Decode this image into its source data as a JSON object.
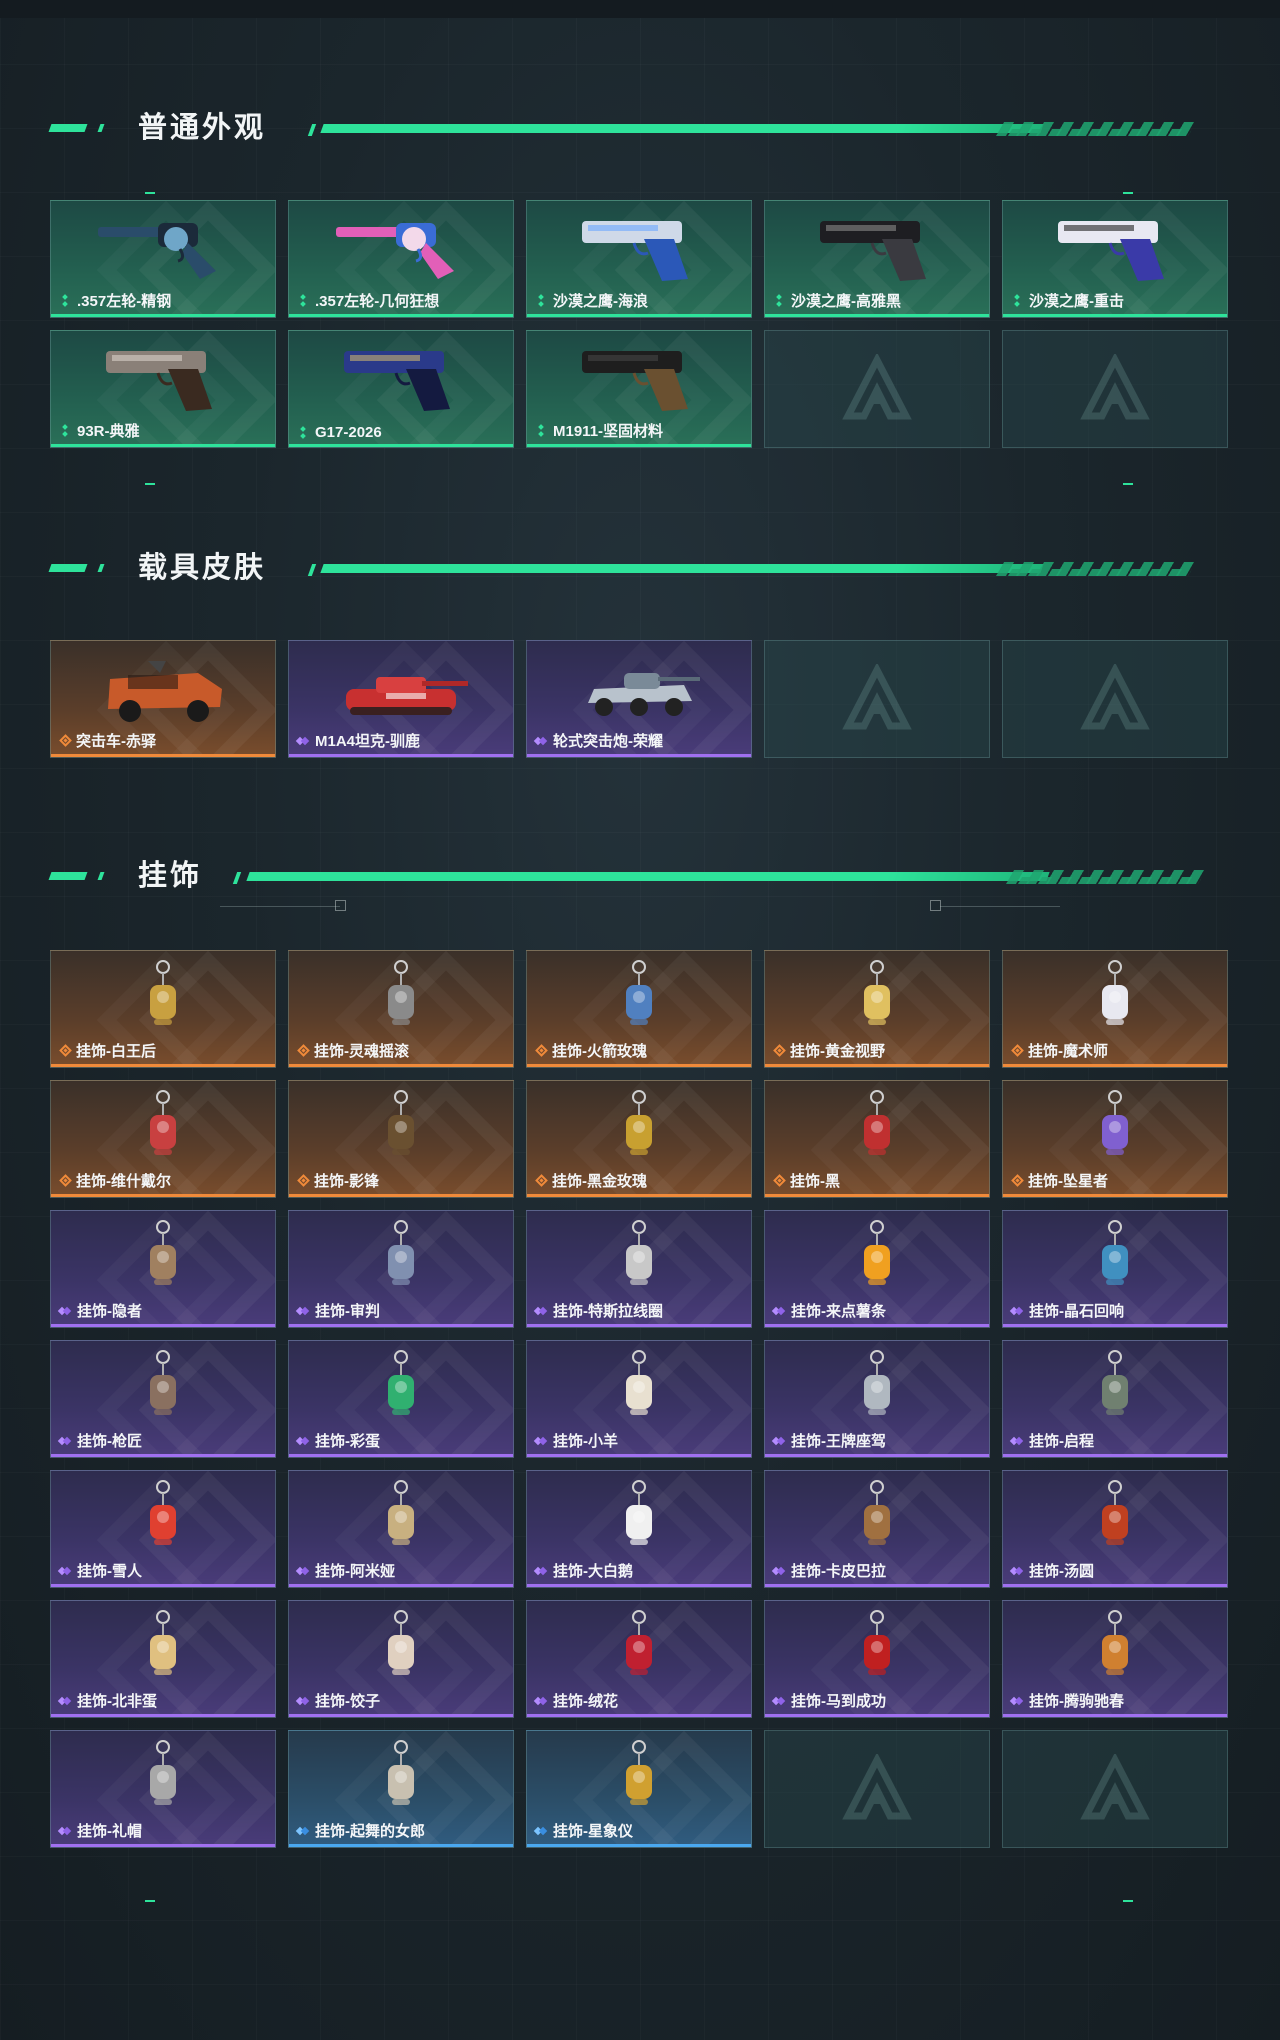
{
  "sections": {
    "weapons": {
      "title": "普通外观"
    },
    "vehicles": {
      "title": "载具皮肤"
    },
    "charms": {
      "title": "挂饰"
    }
  },
  "weapons": [
    {
      "label": ".357左轮-精钢",
      "rarity": "green",
      "icon": "revolver-icon"
    },
    {
      "label": ".357左轮-几何狂想",
      "rarity": "green",
      "icon": "revolver-icon"
    },
    {
      "label": "沙漠之鹰-海浪",
      "rarity": "green",
      "icon": "pistol-icon"
    },
    {
      "label": "沙漠之鹰-高雅黑",
      "rarity": "green",
      "icon": "pistol-icon"
    },
    {
      "label": "沙漠之鹰-重击",
      "rarity": "green",
      "icon": "pistol-icon"
    },
    {
      "label": "93R-典雅",
      "rarity": "green",
      "icon": "pistol-icon"
    },
    {
      "label": "G17-2026",
      "rarity": "green",
      "icon": "pistol-icon"
    },
    {
      "label": "M1911-坚固材料",
      "rarity": "green",
      "icon": "pistol-icon"
    }
  ],
  "vehicles": [
    {
      "label": "突击车-赤驿",
      "rarity": "orange",
      "icon": "assault-vehicle-icon"
    },
    {
      "label": "M1A4坦克-驯鹿",
      "rarity": "purple",
      "icon": "tank-icon"
    },
    {
      "label": "轮式突击炮-荣耀",
      "rarity": "purple",
      "icon": "wheeled-gun-icon"
    }
  ],
  "charms": [
    {
      "label": "挂饰-白王后",
      "rarity": "orange"
    },
    {
      "label": "挂饰-灵魂摇滚",
      "rarity": "orange"
    },
    {
      "label": "挂饰-火箭玫瑰",
      "rarity": "orange"
    },
    {
      "label": "挂饰-黄金视野",
      "rarity": "orange"
    },
    {
      "label": "挂饰-魔术师",
      "rarity": "orange"
    },
    {
      "label": "挂饰-维什戴尔",
      "rarity": "orange"
    },
    {
      "label": "挂饰-影锋",
      "rarity": "orange"
    },
    {
      "label": "挂饰-黑金玫瑰",
      "rarity": "orange"
    },
    {
      "label": "挂饰-黑",
      "rarity": "orange"
    },
    {
      "label": "挂饰-坠星者",
      "rarity": "orange"
    },
    {
      "label": "挂饰-隐者",
      "rarity": "purple"
    },
    {
      "label": "挂饰-审判",
      "rarity": "purple"
    },
    {
      "label": "挂饰-特斯拉线圈",
      "rarity": "purple"
    },
    {
      "label": "挂饰-来点薯条",
      "rarity": "purple"
    },
    {
      "label": "挂饰-晶石回响",
      "rarity": "purple"
    },
    {
      "label": "挂饰-枪匠",
      "rarity": "purple"
    },
    {
      "label": "挂饰-彩蛋",
      "rarity": "purple"
    },
    {
      "label": "挂饰-小羊",
      "rarity": "purple"
    },
    {
      "label": "挂饰-王牌座驾",
      "rarity": "purple"
    },
    {
      "label": "挂饰-启程",
      "rarity": "purple"
    },
    {
      "label": "挂饰-雪人",
      "rarity": "purple"
    },
    {
      "label": "挂饰-阿米娅",
      "rarity": "purple"
    },
    {
      "label": "挂饰-大白鹅",
      "rarity": "purple"
    },
    {
      "label": "挂饰-卡皮巴拉",
      "rarity": "purple"
    },
    {
      "label": "挂饰-汤圆",
      "rarity": "purple"
    },
    {
      "label": "挂饰-北非蛋",
      "rarity": "purple"
    },
    {
      "label": "挂饰-饺子",
      "rarity": "purple"
    },
    {
      "label": "挂饰-绒花",
      "rarity": "purple"
    },
    {
      "label": "挂饰-马到成功",
      "rarity": "purple"
    },
    {
      "label": "挂饰-腾驹驰春",
      "rarity": "purple"
    },
    {
      "label": "挂饰-礼帽",
      "rarity": "purple"
    },
    {
      "label": "挂饰-起舞的女郎",
      "rarity": "blue"
    },
    {
      "label": "挂饰-星象仪",
      "rarity": "blue"
    }
  ],
  "colors": {
    "accent": "#2ee39b",
    "orange": "#f08a3a",
    "purple": "#a070f0",
    "blue": "#4aa8f0"
  }
}
